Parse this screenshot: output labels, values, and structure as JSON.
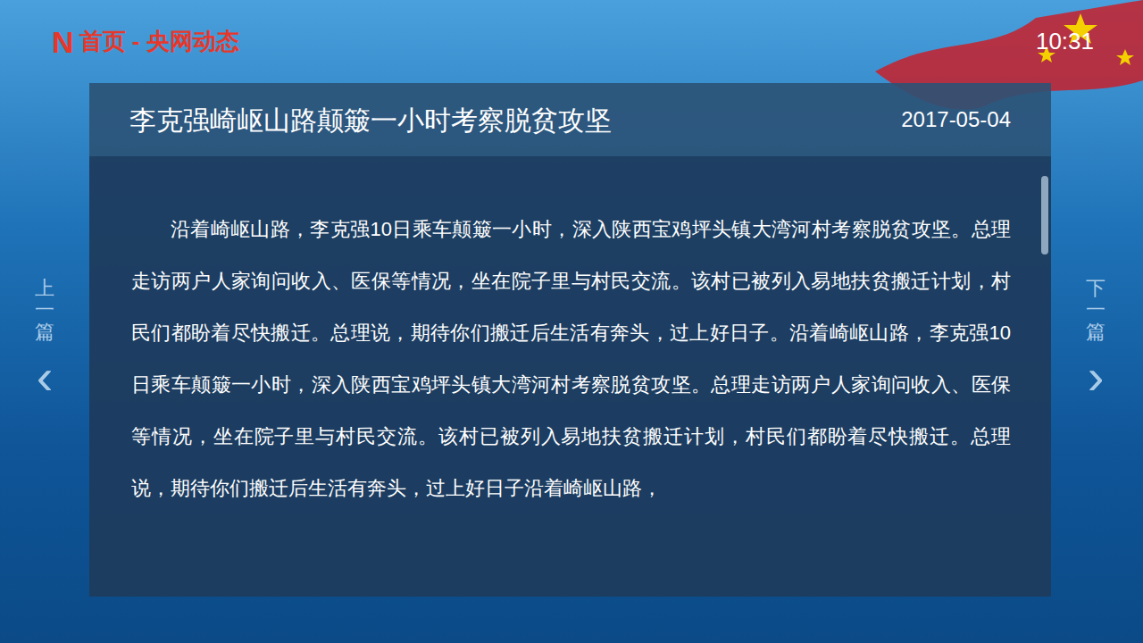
{
  "header": {
    "logo": "N",
    "breadcrumb": "首页 - 央网动态",
    "time": "10:31"
  },
  "article": {
    "title": "李克强崎岖山路颠簸一小时考察脱贫攻坚",
    "date": "2017-05-04",
    "body": "沿着崎岖山路，李克强10日乘车颠簸一小时，深入陕西宝鸡坪头镇大湾河村考察脱贫攻坚。总理走访两户人家询问收入、医保等情况，坐在院子里与村民交流。该村已被列入易地扶贫搬迁计划，村民们都盼着尽快搬迁。总理说，期待你们搬迁后生活有奔头，过上好日子。沿着崎岖山路，李克强10日乘车颠簸一小时，深入陕西宝鸡坪头镇大湾河村考察脱贫攻坚。总理走访两户人家询问收入、医保等情况，坐在院子里与村民交流。该村已被列入易地扶贫搬迁计划，村民们都盼着尽快搬迁。总理说，期待你们搬迁后生活有奔头，过上好日子沿着崎岖山路，"
  },
  "scrollbar": {
    "level": 0.2
  },
  "nav": {
    "prev": {
      "label": "上一篇",
      "arrow": "‹"
    },
    "next": {
      "label": "下一篇",
      "arrow": "›"
    }
  }
}
